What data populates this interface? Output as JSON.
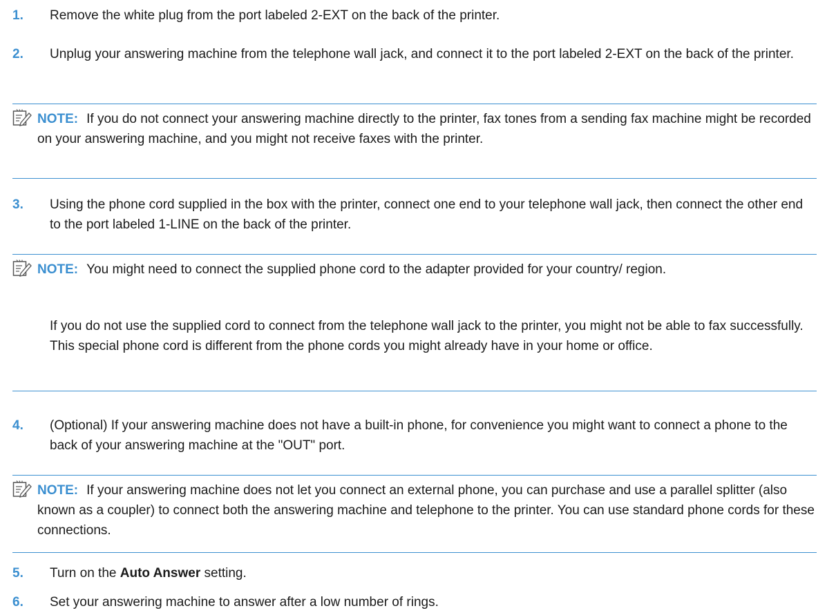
{
  "steps": [
    {
      "number": "1.",
      "text": "Remove the white plug from the port labeled 2-EXT on the back of the printer."
    },
    {
      "number": "2.",
      "text": "Unplug your answering machine from the telephone wall jack, and connect it to the port labeled 2-EXT on the back of the printer."
    },
    {
      "number": "3.",
      "text": "Using the phone cord supplied in the box with the printer, connect one end to your telephone wall jack, then connect the other end to the port labeled 1-LINE on the back of the printer."
    },
    {
      "number": "4.",
      "text": "(Optional) If your answering machine does not have a built-in phone, for convenience you might want to connect a phone to the back of your answering machine at the \"OUT\" port."
    },
    {
      "number": "5.",
      "text_before": "Turn on the ",
      "bold": "Auto Answer",
      "text_after": " setting."
    },
    {
      "number": "6.",
      "text": "Set your answering machine to answer after a low number of rings."
    }
  ],
  "notes": [
    {
      "label": "NOTE:",
      "text": "If you do not connect your answering machine directly to the printer, fax tones from a sending fax machine might be recorded on your answering machine, and you might not receive faxes with the printer."
    },
    {
      "label": "NOTE:",
      "text": "You might need to connect the supplied phone cord to the adapter provided for your country/ region.",
      "text2": "If you do not use the supplied cord to connect from the telephone wall jack to the printer, you might not be able to fax successfully. This special phone cord is different from the phone cords you might already have in your home or office."
    },
    {
      "label": "NOTE:",
      "text": "If your answering machine does not let you connect an external phone, you can purchase and use a parallel splitter (also known as a coupler) to connect both the answering machine and telephone to the printer. You can use standard phone cords for these connections."
    }
  ],
  "colors": {
    "accent": "#3b8fd0",
    "text": "#1a1a1a"
  },
  "icons": {
    "note": "note-pencil-icon"
  }
}
